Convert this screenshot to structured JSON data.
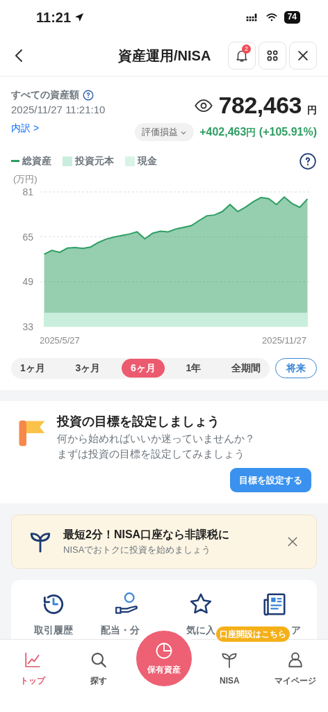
{
  "status_bar": {
    "time": "11:21",
    "battery": "74"
  },
  "header": {
    "title": "資産運用/NISA",
    "notification_count": "2"
  },
  "summary": {
    "label": "すべての資産額",
    "timestamp": "2025/11/27 11:21:10",
    "breakdown_link": "内訳 >",
    "metric_dropdown": "評価損益",
    "total": "782,463",
    "total_unit": "円",
    "gain": "+402,463",
    "gain_unit": "円",
    "gain_percent": "(+105.91%)"
  },
  "legend_extra": [
    {
      "label": "現金",
      "color": "#d9f3e7"
    }
  ],
  "chart": {
    "unit_label": "(万円)",
    "chart_data": {
      "type": "area",
      "categories": [
        null,
        null,
        "2025/5/27",
        null,
        null,
        null,
        null,
        null,
        null,
        null,
        null,
        null,
        null,
        null,
        null,
        null,
        null,
        null,
        null,
        null,
        null,
        null,
        null,
        null,
        null,
        null,
        null,
        null,
        null,
        null,
        null,
        "2025/11/27",
        null,
        null,
        null
      ],
      "ylim": [
        33,
        81
      ],
      "yticks": [
        33,
        49,
        65,
        81
      ],
      "series": [
        {
          "name": "総資産",
          "color": "#2e9e62",
          "values": [
            58.8,
            60.2,
            59.5,
            61.0,
            61.2,
            60.9,
            61.4,
            63.0,
            64.2,
            64.9,
            65.5,
            66.0,
            66.8,
            64.3,
            66.3,
            67.0,
            66.8,
            67.8,
            68.4,
            69.0,
            70.8,
            72.5,
            72.8,
            74.0,
            76.5,
            74.0,
            75.6,
            77.5,
            79.0,
            78.6,
            76.5,
            79.2,
            76.9,
            75.5,
            78.5
          ]
        },
        {
          "name": "投資元本",
          "color": "#c9eedd",
          "values": [
            38,
            38,
            38,
            38,
            38,
            38,
            38,
            38,
            38,
            38,
            38,
            38,
            38,
            38,
            38,
            38,
            38,
            38,
            38,
            38,
            38,
            38,
            38,
            38,
            38,
            38,
            38,
            38,
            38,
            38,
            38,
            38,
            38,
            38,
            38
          ]
        }
      ]
    }
  },
  "periods": [
    {
      "label": "1ヶ月",
      "selected": false
    },
    {
      "label": "3ヶ月",
      "selected": false
    },
    {
      "label": "6ヶ月",
      "selected": true
    },
    {
      "label": "1年",
      "selected": false
    },
    {
      "label": "全期間",
      "selected": false
    }
  ],
  "future_button": "将来",
  "goal_card": {
    "title": "投資の目標を設定しましょう",
    "line_1": "何から始めればいいか迷っていませんか？",
    "line_2": "まずは投資の目標を設定してみましょう",
    "button": "目標を設定する"
  },
  "nisa_banner": {
    "title": "最短2分！NISA口座なら非課税に",
    "subtitle": "NISAでおトクに投資を始めましょう"
  },
  "quick_links": [
    {
      "kind": "history",
      "label": "取引履歴"
    },
    {
      "kind": "dividend",
      "label": "配当・分"
    },
    {
      "kind": "favorite",
      "label": "気に入"
    },
    {
      "kind": "news",
      "label": "ア"
    }
  ],
  "bottom_nav": {
    "items": [
      {
        "kind": "chart",
        "label": "トップ",
        "selected": true
      },
      {
        "kind": "search",
        "label": "探す",
        "selected": false
      },
      {
        "kind": "center",
        "label": "保有資産",
        "selected": false
      },
      {
        "kind": "sprout",
        "label": "NISA",
        "selected": false
      },
      {
        "kind": "person",
        "label": "マイページ",
        "selected": false
      }
    ],
    "tooltip": "口座開設はこちら"
  }
}
